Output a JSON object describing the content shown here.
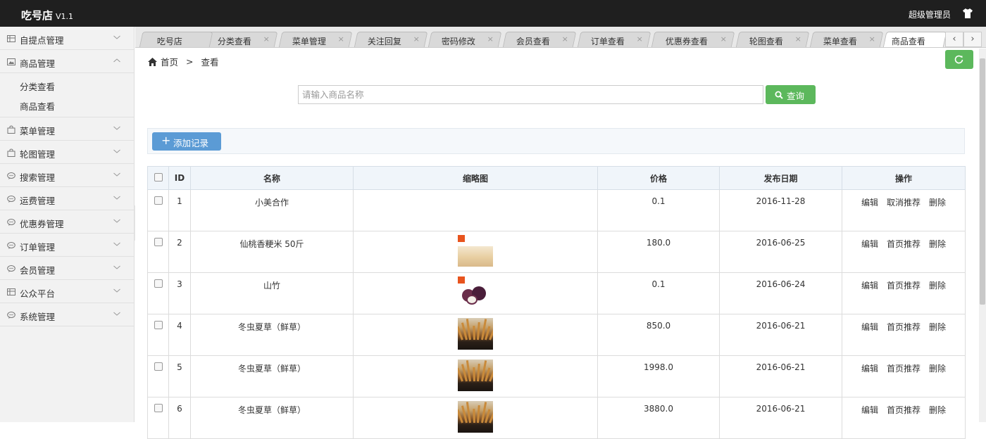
{
  "app": {
    "brand": "吃号店",
    "version": "V1.1",
    "user": "超级管理员"
  },
  "sidebar": {
    "items": [
      {
        "label": "自提点管理",
        "icon": "grid-icon",
        "expanded": false
      },
      {
        "label": "商品管理",
        "icon": "image-icon",
        "expanded": true,
        "children": [
          {
            "label": "分类查看"
          },
          {
            "label": "商品查看"
          }
        ]
      },
      {
        "label": "菜单管理",
        "icon": "bag-icon",
        "expanded": false
      },
      {
        "label": "轮图管理",
        "icon": "bag-icon",
        "expanded": false
      },
      {
        "label": "搜索管理",
        "icon": "chat-icon",
        "expanded": false
      },
      {
        "label": "运费管理",
        "icon": "chat-icon",
        "expanded": false
      },
      {
        "label": "优惠券管理",
        "icon": "chat-icon",
        "expanded": false
      },
      {
        "label": "订单管理",
        "icon": "chat-icon",
        "expanded": false
      },
      {
        "label": "会员管理",
        "icon": "chat-icon",
        "expanded": false
      },
      {
        "label": "公众平台",
        "icon": "grid-icon",
        "expanded": false
      },
      {
        "label": "系统管理",
        "icon": "chat-icon",
        "expanded": false
      }
    ]
  },
  "tabs": [
    {
      "label": "吃号店",
      "closable": false,
      "active": false
    },
    {
      "label": "分类查看",
      "closable": true,
      "active": false
    },
    {
      "label": "菜单管理",
      "closable": true,
      "active": false
    },
    {
      "label": "关注回复",
      "closable": true,
      "active": false
    },
    {
      "label": "密码修改",
      "closable": true,
      "active": false
    },
    {
      "label": "会员查看",
      "closable": true,
      "active": false
    },
    {
      "label": "订单查看",
      "closable": true,
      "active": false
    },
    {
      "label": "优惠券查看",
      "closable": true,
      "active": false
    },
    {
      "label": "轮图查看",
      "closable": true,
      "active": false
    },
    {
      "label": "菜单查看",
      "closable": true,
      "active": false
    },
    {
      "label": "商品查看",
      "closable": false,
      "active": true
    }
  ],
  "tab_nav": {
    "prev": "‹",
    "next": "›"
  },
  "breadcrumb": {
    "home": "首页",
    "separator": ">",
    "current": "查看"
  },
  "search": {
    "placeholder": "请输入商品名称",
    "value": "",
    "button": "查询"
  },
  "toolbar": {
    "add_label": "添加记录"
  },
  "table": {
    "columns": [
      "ID",
      "名称",
      "缩略图",
      "价格",
      "发布日期",
      "操作"
    ],
    "rows": [
      {
        "id": "1",
        "name": "小美合作",
        "thumb": "none",
        "price": "0.1",
        "date": "2016-11-28",
        "actions": [
          "编辑",
          "取消推荐",
          "删除"
        ]
      },
      {
        "id": "2",
        "name": "仙桃香粳米 50斤",
        "thumb": "rice",
        "price": "180.0",
        "date": "2016-06-25",
        "actions": [
          "编辑",
          "首页推荐",
          "删除"
        ]
      },
      {
        "id": "3",
        "name": "山竹",
        "thumb": "fruit",
        "price": "0.1",
        "date": "2016-06-24",
        "actions": [
          "编辑",
          "首页推荐",
          "删除"
        ]
      },
      {
        "id": "4",
        "name": "冬虫夏草（鲜草）",
        "thumb": "cordyceps",
        "price": "850.0",
        "date": "2016-06-21",
        "actions": [
          "编辑",
          "首页推荐",
          "删除"
        ]
      },
      {
        "id": "5",
        "name": "冬虫夏草（鲜草）",
        "thumb": "cordyceps",
        "price": "1998.0",
        "date": "2016-06-21",
        "actions": [
          "编辑",
          "首页推荐",
          "删除"
        ]
      },
      {
        "id": "6",
        "name": "冬虫夏草（鲜草）",
        "thumb": "cordyceps",
        "price": "3880.0",
        "date": "2016-06-21",
        "actions": [
          "编辑",
          "首页推荐",
          "删除"
        ]
      }
    ]
  },
  "colors": {
    "topbar": "#1f1f1f",
    "success": "#5cb85c",
    "primary": "#5b9bd5",
    "sidebar_bg": "#f2f2f2"
  }
}
